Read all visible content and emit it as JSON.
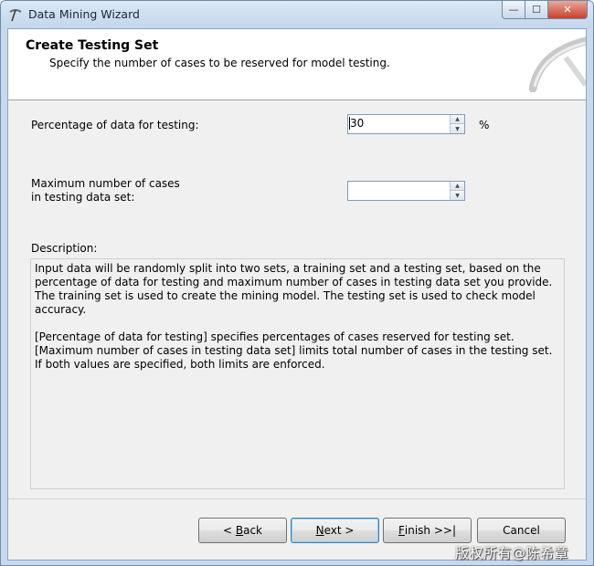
{
  "window": {
    "title": "Data Mining Wizard",
    "controls": {
      "minimize": "—",
      "maximize": "☐",
      "close": "✕"
    }
  },
  "header": {
    "title": "Create Testing Set",
    "subtitle": "Specify the number of cases to be reserved for model testing."
  },
  "fields": {
    "percentage": {
      "label": "Percentage of data for testing:",
      "value": "30",
      "unit": "%"
    },
    "max_cases": {
      "label_line1": "Maximum number of cases",
      "label_line2": "in testing data set:",
      "value": ""
    }
  },
  "description": {
    "label": "Description:",
    "paragraph1": "Input data will be randomly split into two sets, a training set and a testing set, based on the percentage of data for testing and maximum number of cases in testing data set you provide. The training set is used to create the mining model. The testing set is used to check model accuracy.",
    "line1": "[Percentage of data for testing] specifies percentages of cases reserved for testing set.",
    "line2": "[Maximum number of cases in testing data set] limits total number of cases in the testing set.",
    "line3": "If both values are specified, both limits are enforced."
  },
  "buttons": {
    "back": {
      "prefix": "< ",
      "mnemonic": "B",
      "rest": "ack"
    },
    "next": {
      "mnemonic": "N",
      "rest": "ext >"
    },
    "finish": {
      "mnemonic": "F",
      "rest": "inish >>|"
    },
    "cancel": "Cancel"
  },
  "watermark": "版权所有@陈希章",
  "colors": {
    "accent": "#3c7fb1",
    "titlebar": "#c7d9ec",
    "client": "#f0f0f0"
  }
}
